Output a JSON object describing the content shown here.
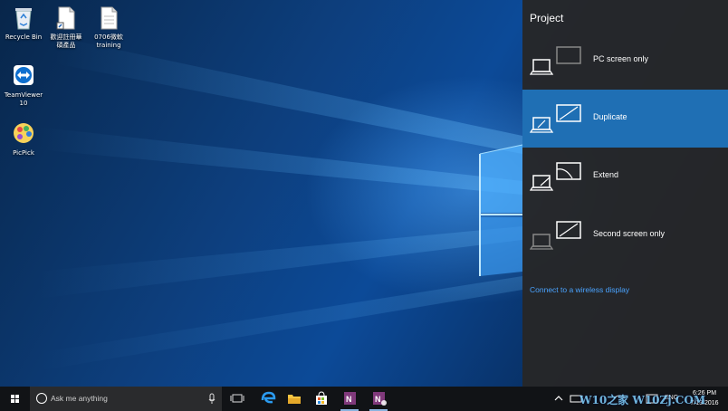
{
  "desktop": {
    "icons": [
      {
        "name": "recycle-bin",
        "label": "Recycle Bin"
      },
      {
        "name": "file-1",
        "label": "歡迎註冊華\n碩產品"
      },
      {
        "name": "file-2",
        "label": "0706微軟\ntraining"
      },
      {
        "name": "teamviewer",
        "label": "TeamViewer\n10"
      },
      {
        "name": "picpick",
        "label": "PicPick"
      }
    ]
  },
  "project_panel": {
    "title": "Project",
    "options": [
      {
        "label": "PC screen only",
        "selected": false
      },
      {
        "label": "Duplicate",
        "selected": true
      },
      {
        "label": "Extend",
        "selected": false
      },
      {
        "label": "Second screen only",
        "selected": false
      }
    ],
    "wireless_link": "Connect to a wireless display"
  },
  "taskbar": {
    "search_placeholder": "Ask me anything",
    "apps": [
      "task-view-icon",
      "edge-icon",
      "file-explorer-icon",
      "store-icon",
      "onenote-icon",
      "onenote-2016-icon"
    ],
    "language": "ENG",
    "time": "6:26 PM",
    "date": "7/13/2016"
  },
  "watermark": "W10之家 W10Zj.COM",
  "colors": {
    "accent": "#1f6fb4",
    "link": "#4aa3ff",
    "panel_bg": "#262628",
    "taskbar_bg": "#111316"
  }
}
